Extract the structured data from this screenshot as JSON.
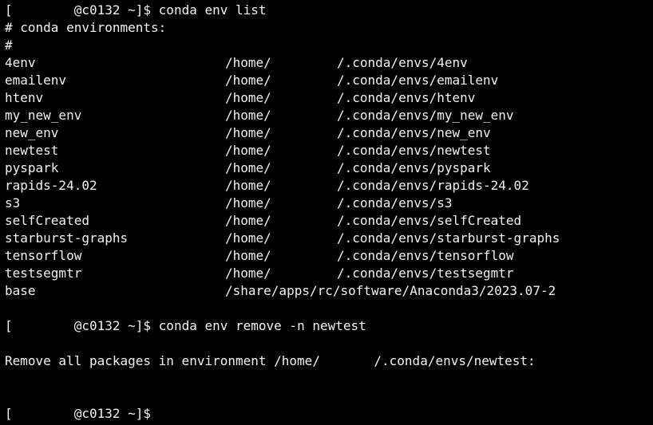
{
  "prompt": {
    "bracket_open": "[",
    "host": "@c0132 ~]$",
    "cmd1": "conda env list",
    "cmd2": "conda env remove -n newtest"
  },
  "header": {
    "comment": "# conda environments:",
    "hash": "#"
  },
  "envs": [
    {
      "name": "4env",
      "home": "/home/",
      "path": "/.conda/envs/4env"
    },
    {
      "name": "emailenv",
      "home": "/home/",
      "path": "/.conda/envs/emailenv"
    },
    {
      "name": "htenv",
      "home": "/home/",
      "path": "/.conda/envs/htenv"
    },
    {
      "name": "my_new_env",
      "home": "/home/",
      "path": "/.conda/envs/my_new_env"
    },
    {
      "name": "new_env",
      "home": "/home/",
      "path": "/.conda/envs/new_env"
    },
    {
      "name": "newtest",
      "home": "/home/",
      "path": "/.conda/envs/newtest"
    },
    {
      "name": "pyspark",
      "home": "/home/",
      "path": "/.conda/envs/pyspark"
    },
    {
      "name": "rapids-24.02",
      "home": "/home/",
      "path": "/.conda/envs/rapids-24.02"
    },
    {
      "name": "s3",
      "home": "/home/",
      "path": "/.conda/envs/s3"
    },
    {
      "name": "selfCreated",
      "home": "/home/",
      "path": "/.conda/envs/selfCreated"
    },
    {
      "name": "starburst-graphs",
      "home": "/home/",
      "path": "/.conda/envs/starburst-graphs"
    },
    {
      "name": "tensorflow",
      "home": "/home/",
      "path": "/.conda/envs/tensorflow"
    },
    {
      "name": "testsegmtr",
      "home": "/home/",
      "path": "/.conda/envs/testsegmtr"
    }
  ],
  "base": {
    "name": "base",
    "path": "/share/apps/rc/software/Anaconda3/2023.07-2"
  },
  "remove_msg": {
    "prefix": "Remove all packages in environment /home/",
    "suffix": "/.conda/envs/newtest:"
  }
}
